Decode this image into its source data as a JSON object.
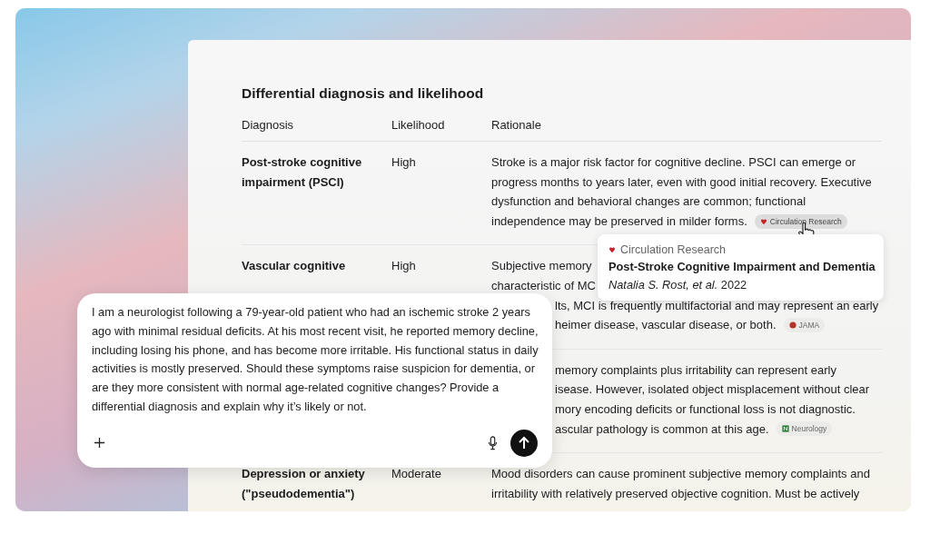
{
  "title": "Differential diagnosis and likelihood",
  "columns": [
    "Diagnosis",
    "Likelihood",
    "Rationale"
  ],
  "rows": [
    {
      "diagnosis": [
        "Post-stroke cognitive",
        "impairment (PSCI)"
      ],
      "likelihood": "High",
      "lines": [
        {
          "text": "Stroke is a major risk factor for cognitive decline. PSCI can emerge or",
          "kind": "full"
        },
        {
          "text": "progress months to years later, even with good initial recovery. Executive",
          "kind": "full"
        },
        {
          "text": "dysfunction and behavioral changes are common; functional",
          "kind": "full"
        },
        {
          "text": "independence may be preserved in milder forms.",
          "kind": "full"
        }
      ],
      "source": {
        "name": "Circulation Research",
        "kind": "heart",
        "hovered": true
      }
    },
    {
      "diagnosis": [
        "Vascular cognitive"
      ],
      "likelihood": "High",
      "lines": [
        {
          "text": "Subjective memory",
          "kind": "full"
        },
        {
          "text": "characteristic of MC",
          "kind": "full"
        },
        {
          "text": "lts, MCI is frequently multifactorial and may represent an early",
          "kind": "clipped"
        },
        {
          "text": "heimer disease, vascular disease, or both.",
          "kind": "clipped"
        }
      ],
      "source": {
        "name": "JAMA",
        "kind": "jama"
      }
    },
    {
      "lines": [
        {
          "text": "memory complaints plus irritability can represent early",
          "kind": "clipped"
        },
        {
          "text": "isease. However, isolated object misplacement without clear",
          "kind": "clipped"
        },
        {
          "text": "mory encoding deficits or functional loss is not diagnostic.",
          "kind": "clipped"
        },
        {
          "text": "ascular pathology is common at this age.",
          "kind": "clipped"
        }
      ],
      "source": {
        "name": "Neurology",
        "kind": "neurology"
      }
    },
    {
      "diagnosis": [
        "Depression or anxiety",
        "(\"pseudodementia\")"
      ],
      "likelihood": "Moderate",
      "lines": [
        {
          "text": "Mood disorders can cause prominent subjective memory complaints and",
          "kind": "full"
        },
        {
          "text": "irritability with relatively preserved objective cognition. Must be actively",
          "kind": "full"
        }
      ]
    }
  ],
  "popover": {
    "source": "Circulation Research",
    "kind": "heart",
    "title": "Post-Stroke Cognitive Impairment and Dementia",
    "authors": "Natalia S. Rost, et al.",
    "year": "2022"
  },
  "prompt": {
    "value": "I am a neurologist following a 79-year-old patient who had an ischemic stroke 2 years ago with minimal residual deficits. At his most recent visit, he reported memory decline, including losing his phone, and has become more irritable. His functional status in daily activities is mostly preserved. Should these symptoms raise suspicion for dementia, or are they more consistent with normal age-related cognitive changes? Provide a differential diagnosis and explain why it’s likely or not."
  }
}
